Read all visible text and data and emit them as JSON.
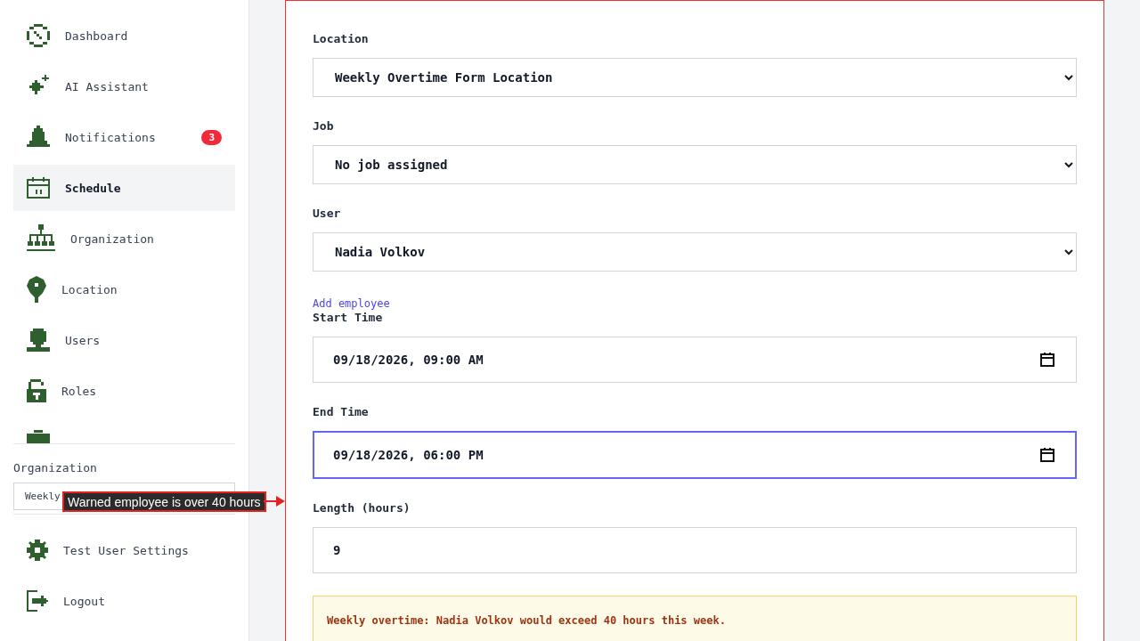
{
  "sidebar": {
    "nav_items": [
      {
        "label": "Dashboard",
        "selected": false
      },
      {
        "label": "AI Assistant",
        "selected": false
      },
      {
        "label": "Notifications",
        "selected": false,
        "badge": "3"
      },
      {
        "label": "Schedule",
        "selected": true
      },
      {
        "label": "Organization",
        "selected": false
      },
      {
        "label": "Location",
        "selected": false
      },
      {
        "label": "Users",
        "selected": false
      },
      {
        "label": "Roles",
        "selected": false
      },
      {
        "selected": false
      }
    ],
    "organization": {
      "label": "Organization",
      "value": "Weekly"
    },
    "footer_items": [
      {
        "label": "Test User Settings"
      },
      {
        "label": "Logout"
      }
    ]
  },
  "form": {
    "fields": [
      {
        "kind": "select",
        "label": "Location",
        "value": "Weekly Overtime Form Location"
      },
      {
        "kind": "select",
        "label": "Job",
        "value": "No job assigned"
      },
      {
        "kind": "select",
        "label": "User",
        "value": "Nadia Volkov"
      },
      {
        "kind": "link",
        "label": "Add employee"
      },
      {
        "kind": "datetime",
        "label": "Start Time",
        "value": "09/18/2026, 09:00 AM",
        "focused": false
      },
      {
        "kind": "datetime",
        "label": "End Time",
        "value": "09/18/2026, 06:00 PM",
        "focused": true
      },
      {
        "kind": "number",
        "label": "Length (hours)",
        "value": "9",
        "focused": false
      }
    ],
    "warning": "Weekly overtime: Nadia Volkov would exceed 40 hours this week."
  },
  "annotation": {
    "text": "Warned employee is over 40 hours"
  }
}
